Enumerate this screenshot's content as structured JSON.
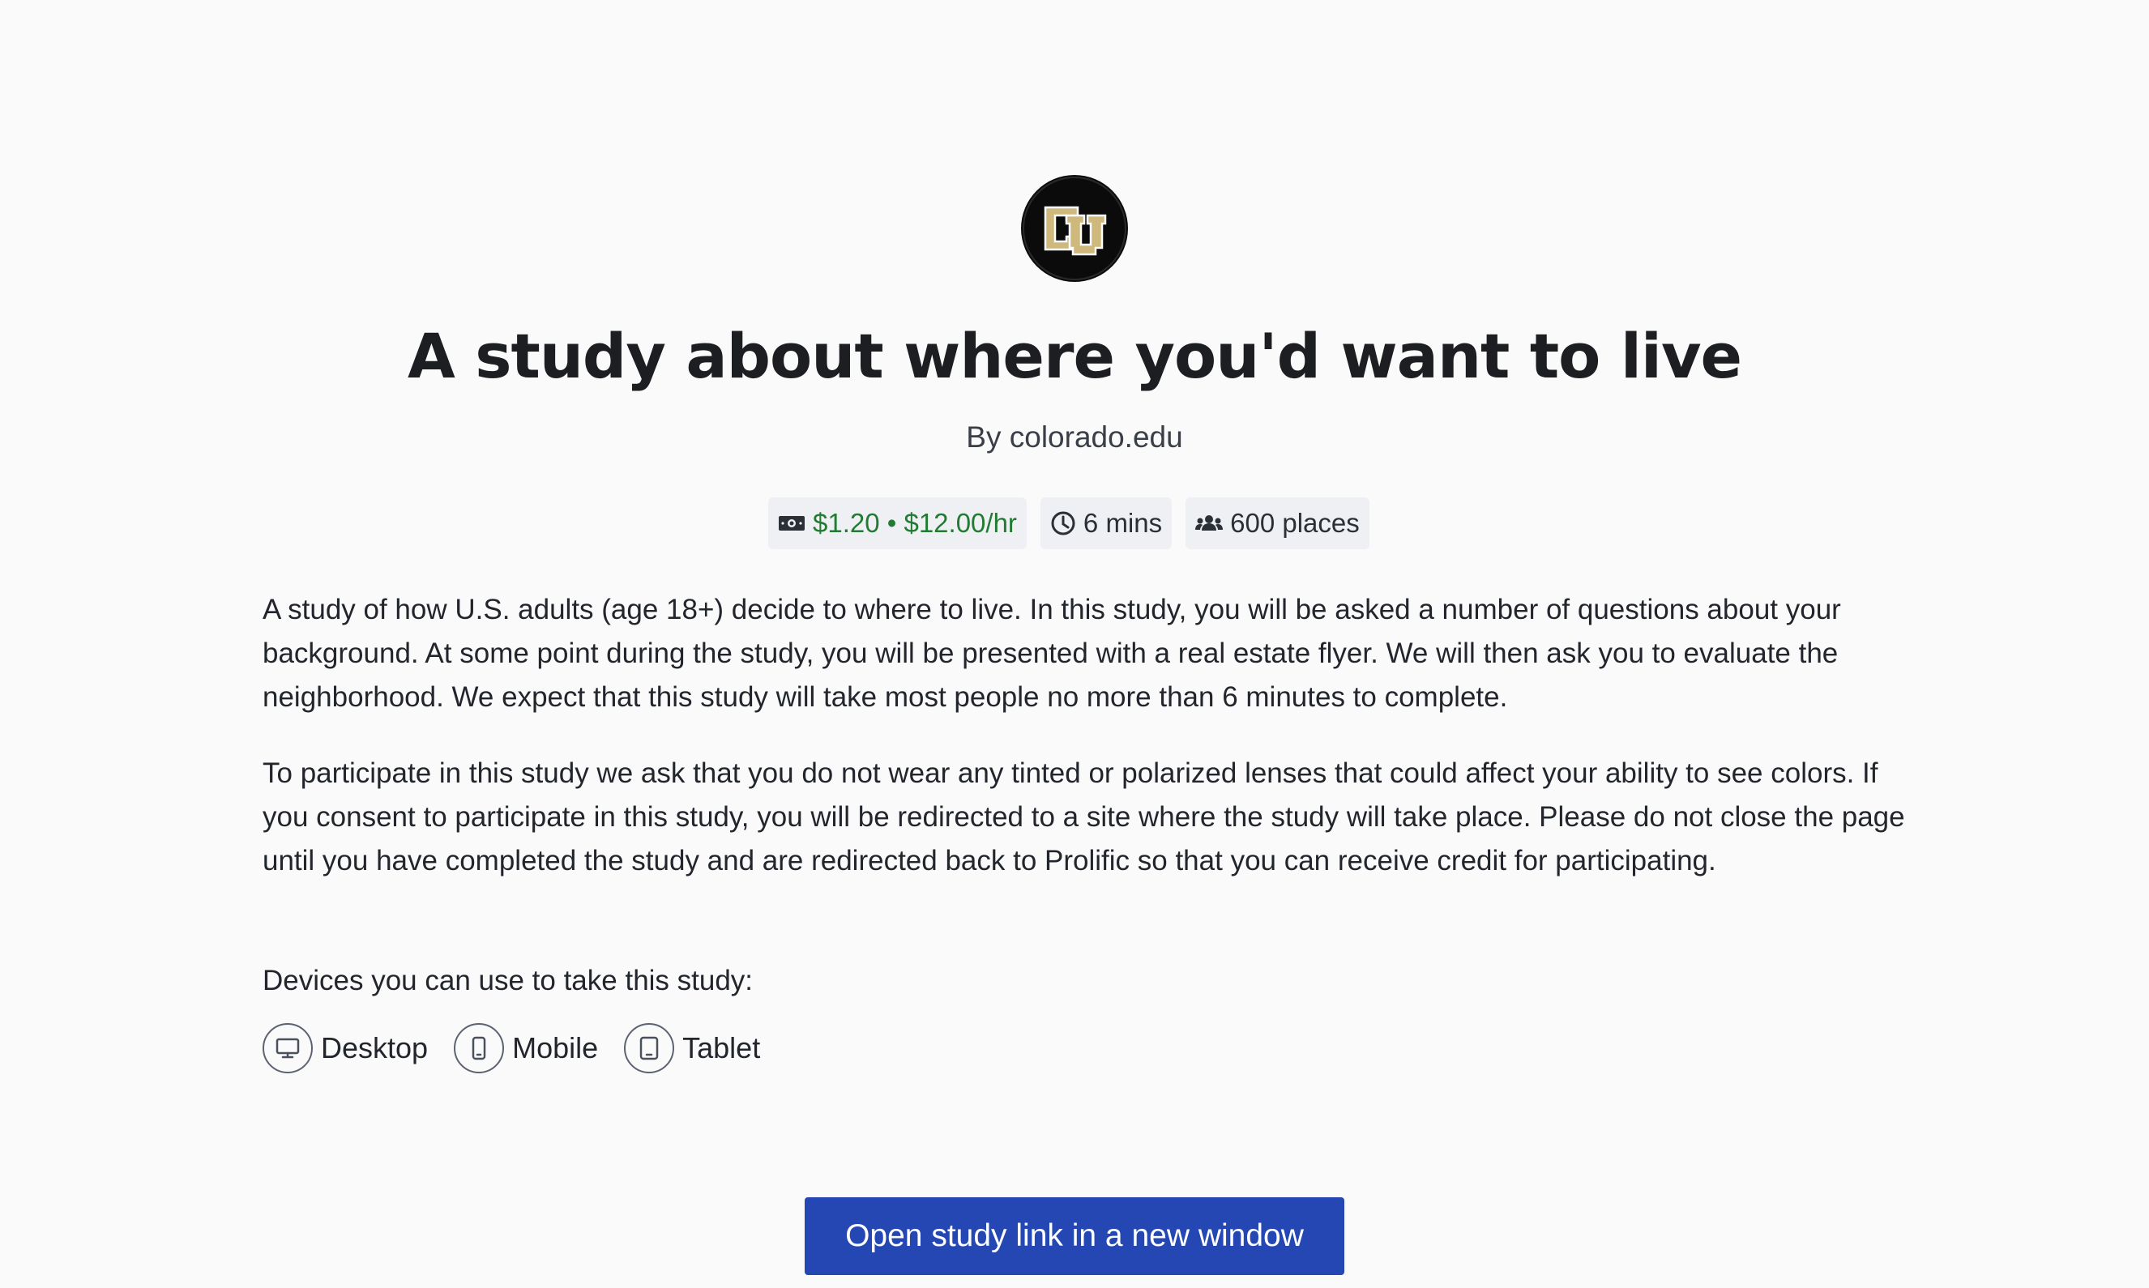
{
  "study": {
    "logo_icon": "university-of-colorado-cu-logo",
    "title": "A study about where you'd want to live",
    "byline": "By colorado.edu"
  },
  "chips": {
    "reward": "$1.20 • $12.00/hr",
    "reward_icon": "money-icon",
    "duration": "6 mins",
    "duration_icon": "clock-icon",
    "places": "600 places",
    "places_icon": "users-icon"
  },
  "description": {
    "paragraph_1": "A study of how U.S. adults (age 18+) decide to where to live. In this study, you will be asked a number of questions about your background. At some point during the study, you will be presented with a real estate flyer. We will then ask you to evaluate the neighborhood. We expect that this study will take most people no more than 6 minutes to complete.",
    "paragraph_2": "To participate in this study we ask that you do not wear any tinted or polarized lenses that could affect your ability to see colors. If you consent to participate in this study, you will be redirected to a site where the study will take place. Please do not close the page until you have completed the study and are redirected back to Prolific so that you can receive credit for participating."
  },
  "devices": {
    "label": "Devices you can use to take this study:",
    "items": [
      {
        "label": "Desktop",
        "icon": "desktop-icon"
      },
      {
        "label": "Mobile",
        "icon": "mobile-icon"
      },
      {
        "label": "Tablet",
        "icon": "tablet-icon"
      }
    ]
  },
  "actions": {
    "open_study_label": "Open study link in a new window"
  },
  "colors": {
    "background": "#fafafb",
    "accent_button": "#2447b3",
    "reward_green": "#237a33",
    "chip_background": "#eef0f3",
    "logo_gold": "#cfb87c"
  }
}
